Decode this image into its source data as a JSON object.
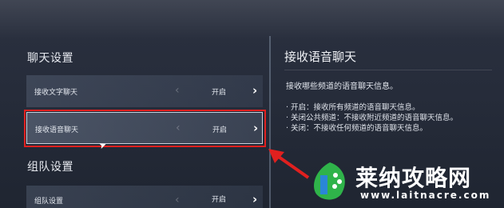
{
  "left_panel": {
    "chat_section_title": "聊天设置",
    "team_section_title": "组队设置",
    "rows": [
      {
        "label": "接收文字聊天",
        "value": "开启"
      },
      {
        "label": "接收语音聊天",
        "value": "开启"
      },
      {
        "label": "组队设置",
        "value": "开启"
      }
    ]
  },
  "right_panel": {
    "title": "接收语音聊天",
    "intro": "接收哪些频道的语音聊天信息。",
    "options": [
      "· 开启：接收所有频道的语音聊天信息。",
      "· 关闭公共频道：不接收附近频道的语音聊天信息。",
      "· 关闭：不接收任何频道的语音聊天信息。"
    ]
  },
  "icons": {
    "prev": "chevron-left-icon",
    "next": "chevron-right-icon",
    "cursor": "mouse-cursor-icon",
    "logo": "leaf-logo-icon"
  },
  "watermark": {
    "title": "莱纳攻略网",
    "url": "www.laitnacre.com"
  },
  "colors": {
    "highlight": "#e0201f",
    "logo_green": "#2fb34a",
    "logo_blue": "#2a86d6"
  }
}
